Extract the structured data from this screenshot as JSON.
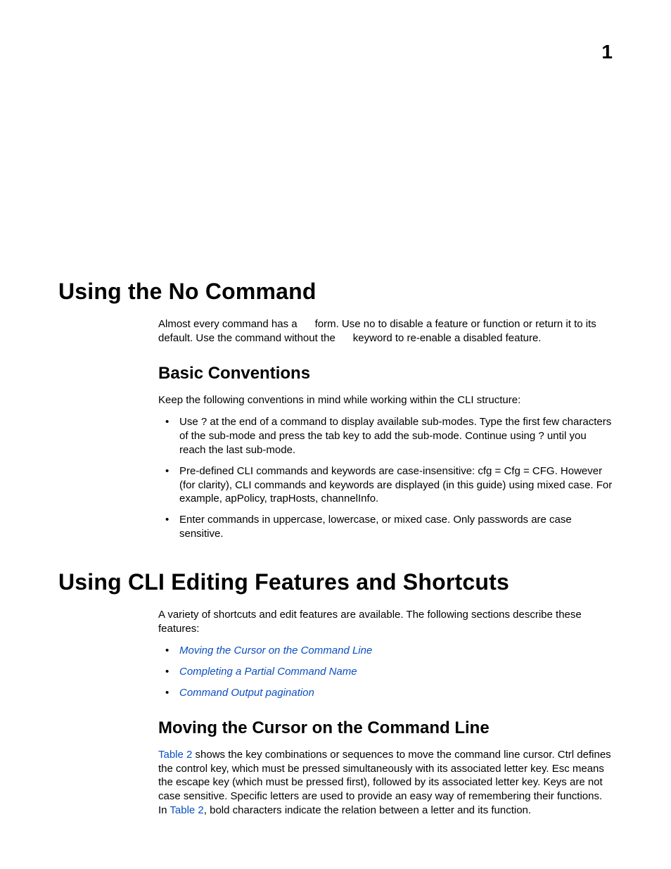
{
  "page_number": "1",
  "sections": {
    "no_command": {
      "heading": "Using the No Command",
      "para": "Almost every command has a      form. Use no to disable a feature or function or return it to its default. Use the command without the      keyword to re-enable a disabled feature.",
      "basic_conventions": {
        "heading": "Basic Conventions",
        "intro": "Keep the following conventions in mind while working within the CLI structure:",
        "items": [
          "Use ? at the end of a command to display available sub-modes. Type the first few characters of the sub-mode and press the tab key to add the sub-mode. Continue using ? until you reach the last sub-mode.",
          "Pre-defined CLI commands and keywords are case-insensitive: cfg = Cfg = CFG. However (for clarity), CLI commands and keywords are displayed (in this guide) using mixed case. For example, apPolicy, trapHosts, channelInfo.",
          "Enter commands in uppercase, lowercase, or mixed case. Only passwords are case sensitive."
        ]
      }
    },
    "cli_features": {
      "heading": "Using CLI Editing Features and Shortcuts",
      "intro": "A variety of shortcuts and edit features are available. The following sections describe these features:",
      "links": [
        "Moving the Cursor on the Command Line",
        "Completing a Partial Command Name",
        "Command Output pagination"
      ],
      "moving_cursor": {
        "heading": "Moving the Cursor on the Command Line",
        "xref1": "Table 2",
        "para_mid": " shows the key combinations or sequences to move the command line cursor. Ctrl defines the control key, which must be pressed simultaneously with its associated letter key. Esc means the escape key (which must be pressed first), followed by its associated letter key. Keys are not case sensitive. Specific letters are used to provide an easy way of remembering their functions. In ",
        "xref2": "Table 2",
        "para_end": ", bold characters indicate the relation between a letter and its function."
      }
    }
  }
}
